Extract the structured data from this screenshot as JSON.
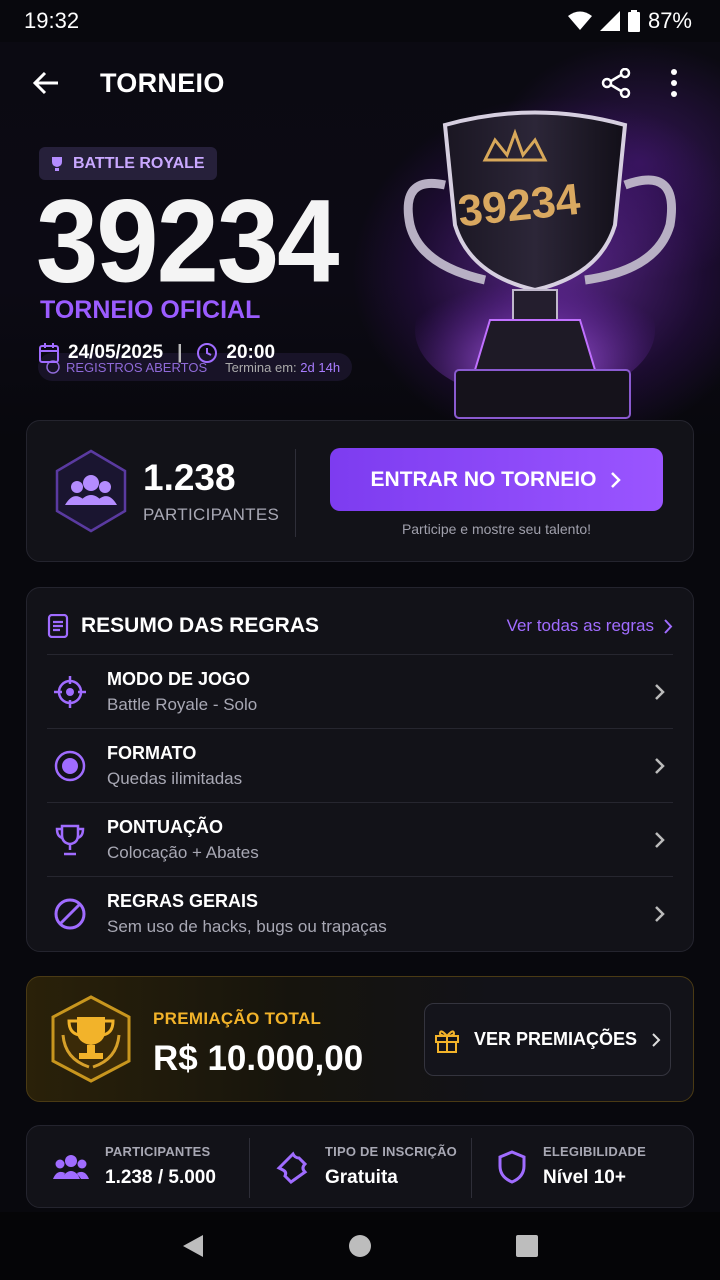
{
  "status": {
    "time": "19:32",
    "battery": "87%"
  },
  "app_bar": {
    "title": "TORNEIO"
  },
  "hero": {
    "badge": "BATTLE ROYALE",
    "number": "39234",
    "subtitle": "TORNEIO OFICIAL",
    "date": "24/05/2025",
    "time": "20:00",
    "registration": "REGISTROS ABERTOS",
    "ends_label": "Termina em:",
    "ends_value": "2d 14h",
    "trophy_text": "39234"
  },
  "participants_card": {
    "count": "1.238",
    "label": "PARTICIPANTES",
    "enter_button": "ENTRAR NO TORNEIO",
    "hint": "Participe e mostre seu talento!"
  },
  "rules": {
    "title": "RESUMO DAS REGRAS",
    "see_all": "Ver todas as regras",
    "items": [
      {
        "icon": "crosshair-icon",
        "title": "MODO DE JOGO",
        "subtitle": "Battle Royale - Solo"
      },
      {
        "icon": "target-icon",
        "title": "FORMATO",
        "subtitle": "Quedas ilimitadas"
      },
      {
        "icon": "trophy-icon",
        "title": "PONTUAÇÃO",
        "subtitle": "Colocação + Abates"
      },
      {
        "icon": "ban-icon",
        "title": "REGRAS GERAIS",
        "subtitle": "Sem uso de hacks, bugs ou trapaças"
      }
    ]
  },
  "prize": {
    "label": "PREMIAÇÃO TOTAL",
    "value": "R$ 10.000,00",
    "button": "VER PREMIAÇÕES"
  },
  "info": [
    {
      "icon": "users-icon",
      "label": "PARTICIPANTES",
      "value": "1.238 / 5.000"
    },
    {
      "icon": "ticket-icon",
      "label": "TIPO DE INSCRIÇÃO",
      "value": "Gratuita"
    },
    {
      "icon": "shield-icon",
      "label": "ELEGIBILIDADE",
      "value": "Nível 10+"
    }
  ],
  "colors": {
    "accent": "#9b5cff",
    "gold": "#f2b32a",
    "background": "#08080d",
    "card": "#121218"
  }
}
